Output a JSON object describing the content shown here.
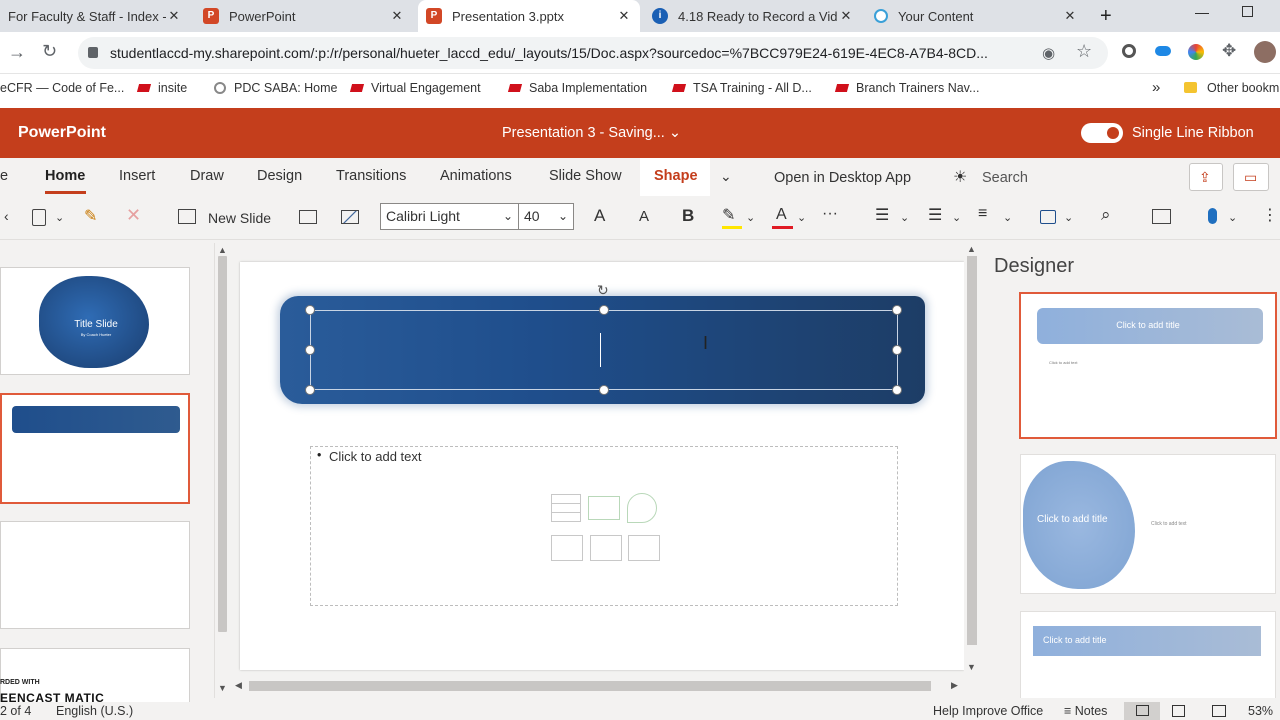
{
  "browser": {
    "tabs": [
      {
        "label": "For Faculty & Staff - Index -"
      },
      {
        "label": "PowerPoint"
      },
      {
        "label": "Presentation 3.pptx"
      },
      {
        "label": "4.18 Ready to Record a Vid"
      },
      {
        "label": "Your Content"
      }
    ],
    "new_tab": "+",
    "close_glyph": "✕",
    "url": "studentlaccd-my.sharepoint.com/:p:/r/personal/hueter_laccd_edu/_layouts/15/Doc.aspx?sourcedoc=%7BCC979E24-619E-4EC8-A7B4-8CD...",
    "bookmarks": [
      {
        "label": "eCFR — Code of Fe..."
      },
      {
        "label": "insite"
      },
      {
        "label": "PDC SABA: Home"
      },
      {
        "label": "Virtual Engagement"
      },
      {
        "label": "Saba Implementation"
      },
      {
        "label": "TSA Training - All D..."
      },
      {
        "label": "Branch Trainers Nav..."
      }
    ],
    "bookmarks_more": "»",
    "other_bookmarks": "Other bookm"
  },
  "app": {
    "name": "PowerPoint",
    "doc_title": "Presentation 3  -  Saving...",
    "single_line_ribbon": "Single Line Ribbon",
    "ribbon_tabs": [
      "e",
      "Home",
      "Insert",
      "Draw",
      "Design",
      "Transitions",
      "Animations",
      "Slide Show",
      "Shape"
    ],
    "open_desktop": "Open in Desktop App",
    "search": "Search",
    "new_slide": "New Slide",
    "font_name": "Calibri Light",
    "font_size": "40",
    "bold": "B",
    "font_grow": "A",
    "font_shrink": "A",
    "more": "···"
  },
  "thumbs": [
    {
      "title": "Title Slide",
      "sub": "By Coach Hueter"
    }
  ],
  "slide": {
    "body_placeholder": "Click to add text",
    "bullet": "•"
  },
  "designer": {
    "title": "Designer",
    "cards": [
      {
        "title": "Click to add title",
        "text": "Click to add text"
      },
      {
        "title": "Click to add title",
        "text": "Click to add text"
      },
      {
        "title": "Click to add title"
      }
    ]
  },
  "status": {
    "slide_of": "2 of 4",
    "language": "English (U.S.)",
    "help": "Help Improve Office",
    "notes": "Notes",
    "zoom": "53%",
    "watermark_top": "RDED WITH",
    "watermark": "EENCAST  MATIC"
  },
  "colors": {
    "brand": "#c43e1c",
    "accent_underline": "#c43e1c",
    "shape_tab": "#c43e1c",
    "blue": "#1f4e8c"
  }
}
